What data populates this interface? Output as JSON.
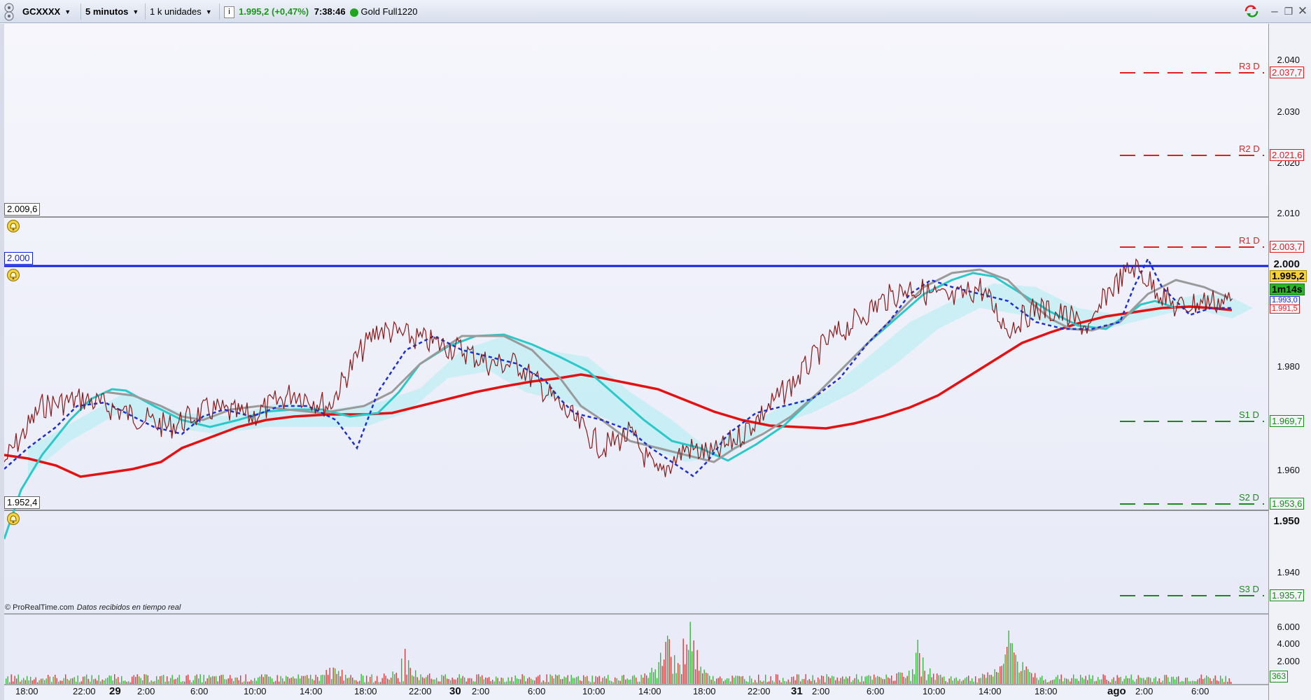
{
  "toolbar": {
    "instrument": "GCXXXX",
    "timeframe": "5 minutos",
    "units": "1 k unidades",
    "last_price": "1.995,2 (+0,47%)",
    "time": "7:38:46",
    "feed_name": "Gold Full1220",
    "icons": [
      "handle-icon",
      "dropdown-icon",
      "info-icon",
      "status-dot-icon",
      "sync-icon",
      "minimize-icon",
      "restore-icon",
      "close-icon"
    ]
  },
  "chart": {
    "credit_site": "© ProRealTime.com",
    "credit_text": "Datos recibidos en tiempo real",
    "alarm_high": "2.009,6",
    "alarm_line": "2.000",
    "alarm_low": "1.952,4",
    "colors": {
      "price": "#8b1a1a",
      "ema": "#ff2020",
      "ma_red": "#e31212",
      "ma_cyan": "#2ac9c9",
      "ma_gray": "#9a9a9a",
      "dash_blue": "#1c2fd0",
      "alarm_line": "#1020e0",
      "resistance": "#e02020",
      "support": "#1a8a1a",
      "vol_up": "#34b934",
      "vol_down": "#dd3a3a"
    }
  },
  "levels": [
    {
      "name": "R3 D",
      "value": "2.037,7",
      "kind": "resistance"
    },
    {
      "name": "R2 D",
      "value": "2.021,6",
      "kind": "resistance"
    },
    {
      "name": "R1 D",
      "value": "2.003,7",
      "kind": "resistance"
    },
    {
      "name": "S1 D",
      "value": "1.969,7",
      "kind": "support"
    },
    {
      "name": "S2 D",
      "value": "1.953,6",
      "kind": "support"
    },
    {
      "name": "S3 D",
      "value": "1.935,7",
      "kind": "support"
    }
  ],
  "price_axis": {
    "ticks": [
      "2.040",
      "2.030",
      "2.020",
      "2.010",
      "2.000",
      "1.980",
      "1.960",
      "1.950",
      "1.940"
    ],
    "current_price": "1.995,2",
    "countdown": "1m14s",
    "tag_blue": "1.993,0",
    "tag_red": "1.991,5"
  },
  "volume_axis": {
    "ticks": [
      "6.000",
      "4.000",
      "2.000"
    ],
    "current": "363"
  },
  "time_axis": {
    "labels": [
      "18:00",
      "22:00",
      "29",
      "2:00",
      "6:00",
      "10:00",
      "14:00",
      "18:00",
      "22:00",
      "30",
      "2:00",
      "6:00",
      "10:00",
      "14:00",
      "18:00",
      "22:00",
      "31",
      "2:00",
      "6:00",
      "10:00",
      "14:00",
      "18:00",
      "ago",
      "2:00",
      "6:00"
    ]
  }
}
